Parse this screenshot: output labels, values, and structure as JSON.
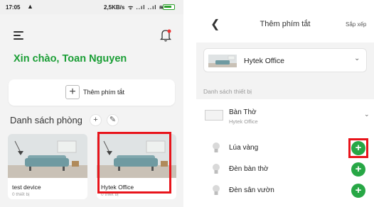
{
  "left_screen": {
    "status_bar": {
      "time": "17:05",
      "speed": "2,5KB/s",
      "signal": "ᯤ ..ıl ..ıl ≋"
    },
    "greeting": "Xin chào, Toan Nguyen",
    "add_shortcut_label": "Thêm phím tắt",
    "room_list_title": "Danh sách phòng",
    "rooms": [
      {
        "name": "test device",
        "device_count": "0 thiết bị"
      },
      {
        "name": "Hytek Office",
        "device_count": "0 thiết bị"
      }
    ]
  },
  "right_screen": {
    "title": "Thêm phím tắt",
    "sort_label": "Sắp xếp",
    "selected_room": "Hytek Office",
    "section_label": "Danh sách thiết bị",
    "device": {
      "name": "Bàn Thờ",
      "room": "Hytek Office"
    },
    "sub_devices": [
      {
        "label": "Lúa vàng"
      },
      {
        "label": "Đèn bàn thờ"
      },
      {
        "label": "Đèn sân vườn"
      }
    ]
  },
  "colors": {
    "accent_green": "#1a9e35",
    "add_button_green": "#27a745",
    "highlight_red": "#e8141b"
  },
  "icons": [
    "menu-icon",
    "bell-icon",
    "plus-icon",
    "pencil-icon",
    "back-icon",
    "chevron-down-icon",
    "bulb-icon"
  ]
}
